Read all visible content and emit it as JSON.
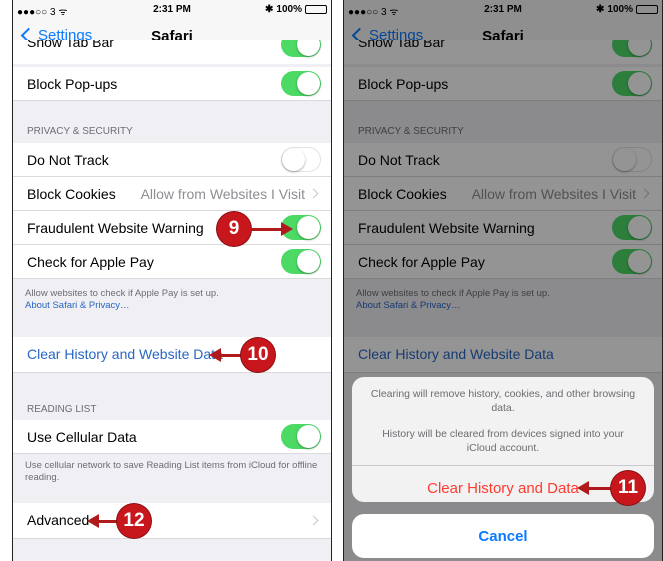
{
  "status": {
    "carrier": "●●●○○ 3 ᯤ",
    "time": "2:31 PM",
    "battery": "100%",
    "bluetooth": "✱"
  },
  "nav": {
    "back_label": "Settings",
    "title": "Safari"
  },
  "rows": {
    "partial_label": "Show Tab Bar",
    "block_popups": "Block Pop-ups",
    "privacy_header": "PRIVACY & SECURITY",
    "do_not_track": "Do Not Track",
    "block_cookies": "Block Cookies",
    "block_cookies_value": "Allow from Websites I Visit",
    "fraud_warning": "Fraudulent Website Warning",
    "apple_pay": "Check for Apple Pay",
    "apple_pay_footer": "Allow websites to check if Apple Pay is set up.",
    "about_link": "About Safari & Privacy…",
    "clear_history": "Clear History and Website Data",
    "reading_header": "READING LIST",
    "cellular": "Use Cellular Data",
    "cellular_footer": "Use cellular network to save Reading List items from iCloud for offline reading.",
    "advanced": "Advanced"
  },
  "toggles": {
    "block_popups": true,
    "do_not_track": false,
    "fraud_warning": true,
    "apple_pay": true,
    "cellular": true
  },
  "sheet": {
    "message1": "Clearing will remove history, cookies, and other browsing data.",
    "message2": "History will be cleared from devices signed into your iCloud account.",
    "confirm": "Clear History and Data",
    "cancel": "Cancel"
  },
  "callouts": {
    "c9": "9",
    "c10": "10",
    "c11": "11",
    "c12": "12"
  },
  "colors": {
    "accent": "#0a7bff",
    "toggle_on": "#4cd964",
    "destructive": "#ff3b30",
    "callout": "#c8161d"
  }
}
